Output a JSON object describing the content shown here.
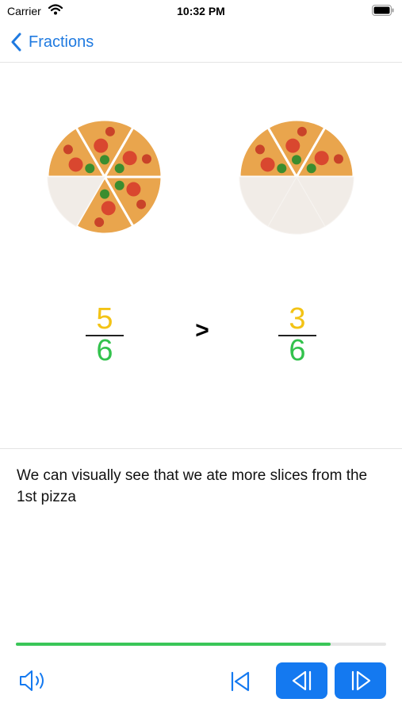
{
  "status_bar": {
    "carrier": "Carrier",
    "time": "10:32 PM"
  },
  "nav": {
    "back_label": "Fractions"
  },
  "comparison": {
    "left": {
      "numerator": "5",
      "denominator": "6",
      "slices_total": 6,
      "slices_shown": 5
    },
    "operator": ">",
    "right": {
      "numerator": "3",
      "denominator": "6",
      "slices_total": 6,
      "slices_shown": 3
    }
  },
  "explanation": "We can visually see that we ate more slices from the 1st pizza",
  "progress": 0.85,
  "colors": {
    "accent": "#1479f0",
    "numerator": "#f3c315",
    "denominator": "#33c24d",
    "progress": "#3ac658"
  },
  "icons": {
    "back": "chevron-left-icon",
    "sound": "speaker-icon",
    "restart": "skip-to-start-icon",
    "prev": "step-back-icon",
    "next": "step-forward-icon"
  }
}
